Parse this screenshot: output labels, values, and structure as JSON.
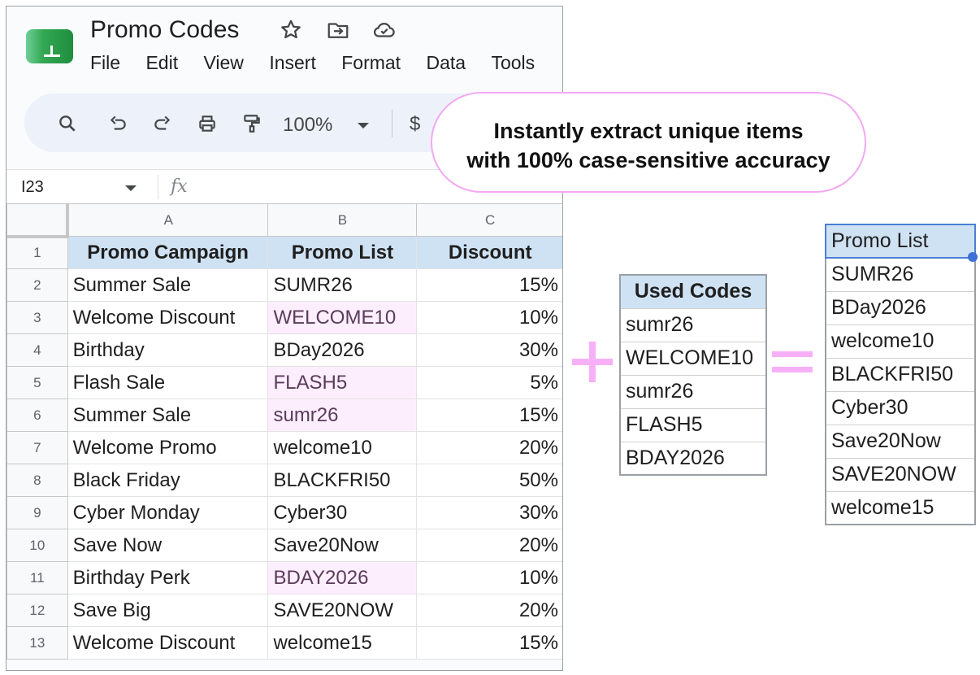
{
  "app": {
    "title": "Promo Codes",
    "menu": [
      "File",
      "Edit",
      "View",
      "Insert",
      "Format",
      "Data",
      "Tools"
    ],
    "header_icons": [
      "star-icon",
      "move-to-folder-icon",
      "cloud-saved-icon"
    ],
    "toolbar": {
      "icons": [
        "search-icon",
        "undo-icon",
        "redo-icon",
        "print-icon",
        "paint-format-icon"
      ],
      "zoom": "100%",
      "currency": "$"
    },
    "formula_bar": {
      "name_box": "I23",
      "fx": "fx"
    }
  },
  "sheet": {
    "columns": [
      "A",
      "B",
      "C"
    ],
    "header": {
      "row": "1",
      "cells": [
        "Promo Campaign",
        "Promo List",
        "Discount"
      ]
    },
    "rows": [
      {
        "row": "2",
        "campaign": "Summer Sale",
        "code": "SUMR26",
        "discount": "15%",
        "highlight": false
      },
      {
        "row": "3",
        "campaign": "Welcome Discount",
        "code": "WELCOME10",
        "discount": "10%",
        "highlight": true
      },
      {
        "row": "4",
        "campaign": "Birthday",
        "code": "BDay2026",
        "discount": "30%",
        "highlight": false
      },
      {
        "row": "5",
        "campaign": "Flash Sale",
        "code": "FLASH5",
        "discount": "5%",
        "highlight": true
      },
      {
        "row": "6",
        "campaign": "Summer Sale",
        "code": "sumr26",
        "discount": "15%",
        "highlight": true
      },
      {
        "row": "7",
        "campaign": "Welcome Promo",
        "code": "welcome10",
        "discount": "20%",
        "highlight": false
      },
      {
        "row": "8",
        "campaign": "Black Friday",
        "code": "BLACKFRI50",
        "discount": "50%",
        "highlight": false
      },
      {
        "row": "9",
        "campaign": "Cyber Monday",
        "code": "Cyber30",
        "discount": "30%",
        "highlight": false
      },
      {
        "row": "10",
        "campaign": "Save Now",
        "code": "Save20Now",
        "discount": "20%",
        "highlight": false
      },
      {
        "row": "11",
        "campaign": "Birthday Perk",
        "code": "BDAY2026",
        "discount": "10%",
        "highlight": true
      },
      {
        "row": "12",
        "campaign": "Save Big",
        "code": "SAVE20NOW",
        "discount": "20%",
        "highlight": false
      },
      {
        "row": "13",
        "campaign": "Welcome Discount",
        "code": "welcome15",
        "discount": "15%",
        "highlight": false
      }
    ]
  },
  "callout": {
    "line1": "Instantly extract unique items",
    "line2": "with 100% case-sensitive accuracy"
  },
  "used_codes": {
    "header": "Used Codes",
    "items": [
      "sumr26",
      "WELCOME10",
      "sumr26",
      "FLASH5",
      "BDAY2026"
    ]
  },
  "result": {
    "header": "Promo List",
    "items": [
      "SUMR26",
      "BDay2026",
      "welcome10",
      "BLACKFRI50",
      "Cyber30",
      "Save20Now",
      "SAVE20NOW",
      "welcome15"
    ]
  },
  "colors": {
    "header_fill": "#cfe2f3",
    "highlight_fill": "#fdeefd",
    "accent_pink": "#f7b0f7",
    "selection_blue": "#4a7fd6"
  }
}
